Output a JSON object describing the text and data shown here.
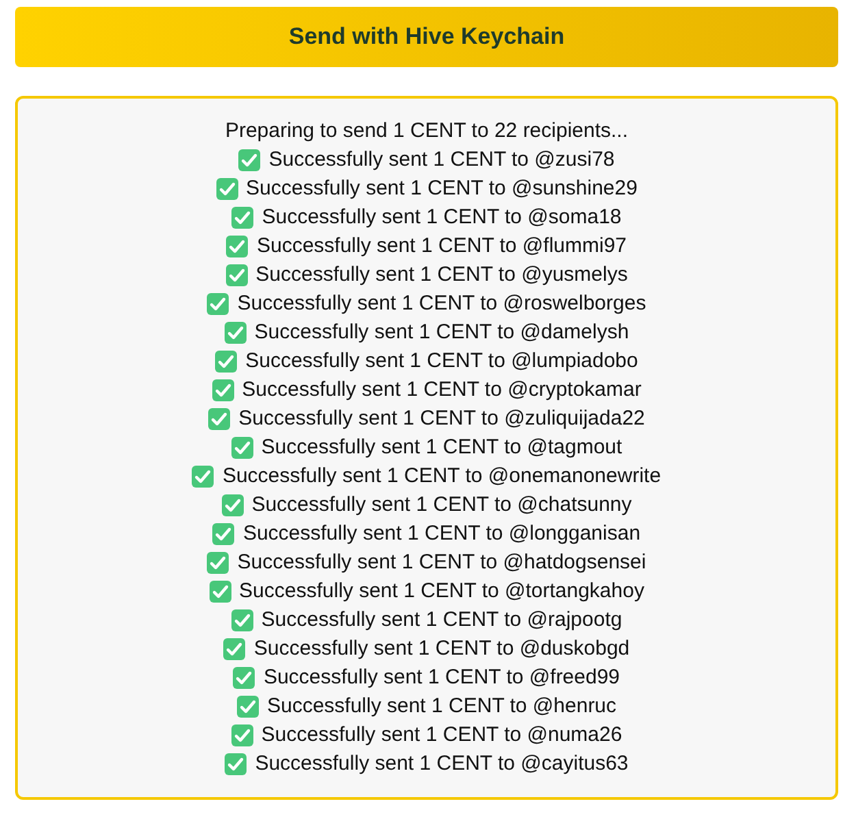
{
  "send_button": {
    "label": "Send with Hive Keychain"
  },
  "log": {
    "header": "Preparing to send 1 CENT to 22 recipients...",
    "entries": [
      {
        "kind": "success",
        "text": "Successfully sent 1 CENT to @zusi78"
      },
      {
        "kind": "success",
        "text": "Successfully sent 1 CENT to @sunshine29"
      },
      {
        "kind": "success",
        "text": "Successfully sent 1 CENT to @soma18"
      },
      {
        "kind": "success",
        "text": "Successfully sent 1 CENT to @flummi97"
      },
      {
        "kind": "success",
        "text": "Successfully sent 1 CENT to @yusmelys"
      },
      {
        "kind": "success",
        "text": "Successfully sent 1 CENT to @roswelborges"
      },
      {
        "kind": "success",
        "text": "Successfully sent 1 CENT to @damelysh"
      },
      {
        "kind": "success",
        "text": "Successfully sent 1 CENT to @lumpiadobo"
      },
      {
        "kind": "success",
        "text": "Successfully sent 1 CENT to @cryptokamar"
      },
      {
        "kind": "success",
        "text": "Successfully sent 1 CENT to @zuliquijada22"
      },
      {
        "kind": "success",
        "text": "Successfully sent 1 CENT to @tagmout"
      },
      {
        "kind": "success",
        "text": "Successfully sent 1 CENT to @onemanonewrite"
      },
      {
        "kind": "success",
        "text": "Successfully sent 1 CENT to @chatsunny"
      },
      {
        "kind": "success",
        "text": "Successfully sent 1 CENT to @longganisan"
      },
      {
        "kind": "success",
        "text": "Successfully sent 1 CENT to @hatdogsensei"
      },
      {
        "kind": "success",
        "text": "Successfully sent 1 CENT to @tortangkahoy"
      },
      {
        "kind": "success",
        "text": "Successfully sent 1 CENT to @rajpootg"
      },
      {
        "kind": "success",
        "text": "Successfully sent 1 CENT to @duskobgd"
      },
      {
        "kind": "success",
        "text": "Successfully sent 1 CENT to @freed99"
      },
      {
        "kind": "success",
        "text": "Successfully sent 1 CENT to @henruc"
      },
      {
        "kind": "success",
        "text": "Successfully sent 1 CENT to @numa26"
      },
      {
        "kind": "success",
        "text": "Successfully sent 1 CENT to @cayitus63"
      }
    ]
  }
}
